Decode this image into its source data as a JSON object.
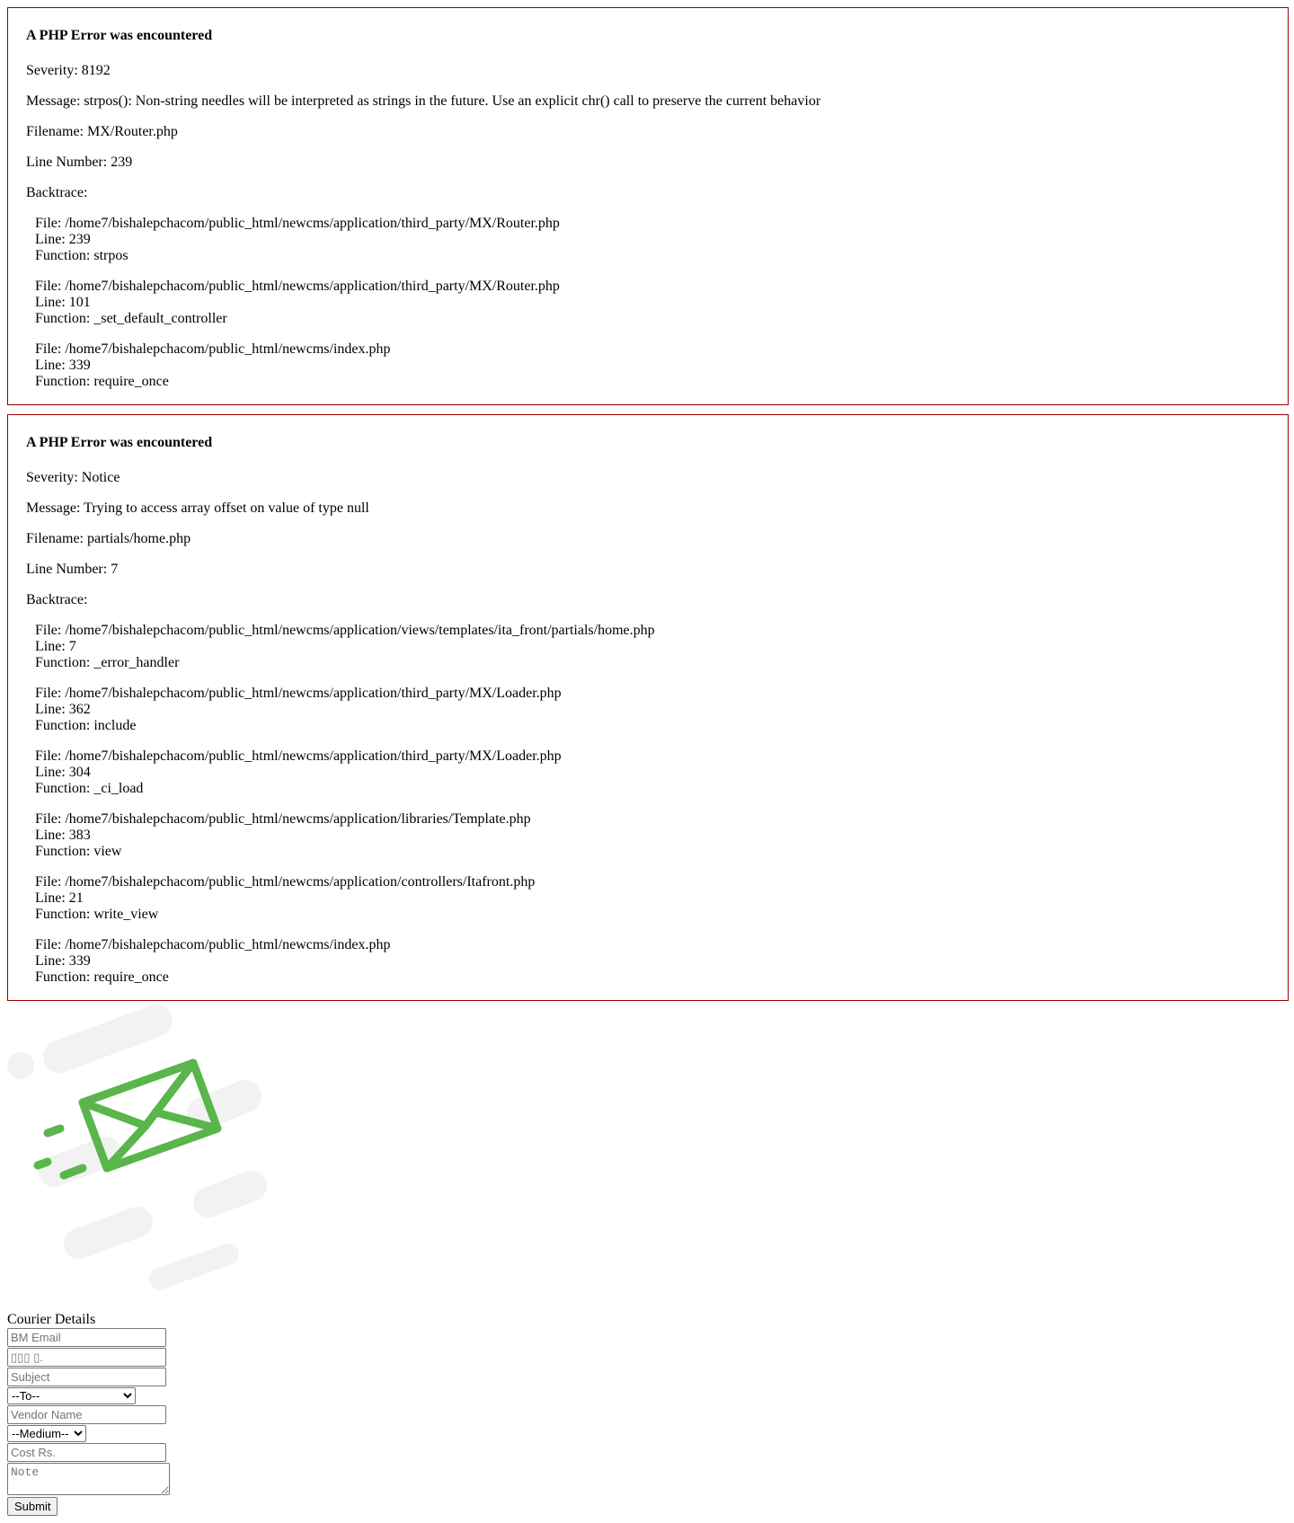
{
  "errors": [
    {
      "heading": "A PHP Error was encountered",
      "severity": "Severity: 8192",
      "message": "Message: strpos(): Non-string needles will be interpreted as strings in the future. Use an explicit chr() call to preserve the current behavior",
      "filename": "Filename: MX/Router.php",
      "line_number": "Line Number: 239",
      "backtrace_label": "Backtrace:",
      "trace": [
        {
          "file": "File: /home7/bishalepchacom/public_html/newcms/application/third_party/MX/Router.php",
          "line": "Line: 239",
          "function": "Function: strpos"
        },
        {
          "file": "File: /home7/bishalepchacom/public_html/newcms/application/third_party/MX/Router.php",
          "line": "Line: 101",
          "function": "Function: _set_default_controller"
        },
        {
          "file": "File: /home7/bishalepchacom/public_html/newcms/index.php",
          "line": "Line: 339",
          "function": "Function: require_once"
        }
      ]
    },
    {
      "heading": "A PHP Error was encountered",
      "severity": "Severity: Notice",
      "message": "Message: Trying to access array offset on value of type null",
      "filename": "Filename: partials/home.php",
      "line_number": "Line Number: 7",
      "backtrace_label": "Backtrace:",
      "trace": [
        {
          "file": "File: /home7/bishalepchacom/public_html/newcms/application/views/templates/ita_front/partials/home.php",
          "line": "Line: 7",
          "function": "Function: _error_handler"
        },
        {
          "file": "File: /home7/bishalepchacom/public_html/newcms/application/third_party/MX/Loader.php",
          "line": "Line: 362",
          "function": "Function: include"
        },
        {
          "file": "File: /home7/bishalepchacom/public_html/newcms/application/third_party/MX/Loader.php",
          "line": "Line: 304",
          "function": "Function: _ci_load"
        },
        {
          "file": "File: /home7/bishalepchacom/public_html/newcms/application/libraries/Template.php",
          "line": "Line: 383",
          "function": "Function: view"
        },
        {
          "file": "File: /home7/bishalepchacom/public_html/newcms/application/controllers/Itafront.php",
          "line": "Line: 21",
          "function": "Function: write_view"
        },
        {
          "file": "File: /home7/bishalepchacom/public_html/newcms/index.php",
          "line": "Line: 339",
          "function": "Function: require_once"
        }
      ]
    }
  ],
  "illustration": {
    "icon": "flying-envelope-icon",
    "accent_color": "#5ab54b",
    "streak_color": "#f2f2f2"
  },
  "form": {
    "title": "Courier Details",
    "bm_email_placeholder": "BM Email",
    "number_placeholder": "▯▯▯ ▯.",
    "subject_placeholder": "Subject",
    "to_selected": "--To--",
    "vendor_placeholder": "Vendor Name",
    "medium_selected": "--Medium--",
    "cost_placeholder": "Cost Rs.",
    "note_placeholder": "Note",
    "submit_label": "Submit"
  }
}
